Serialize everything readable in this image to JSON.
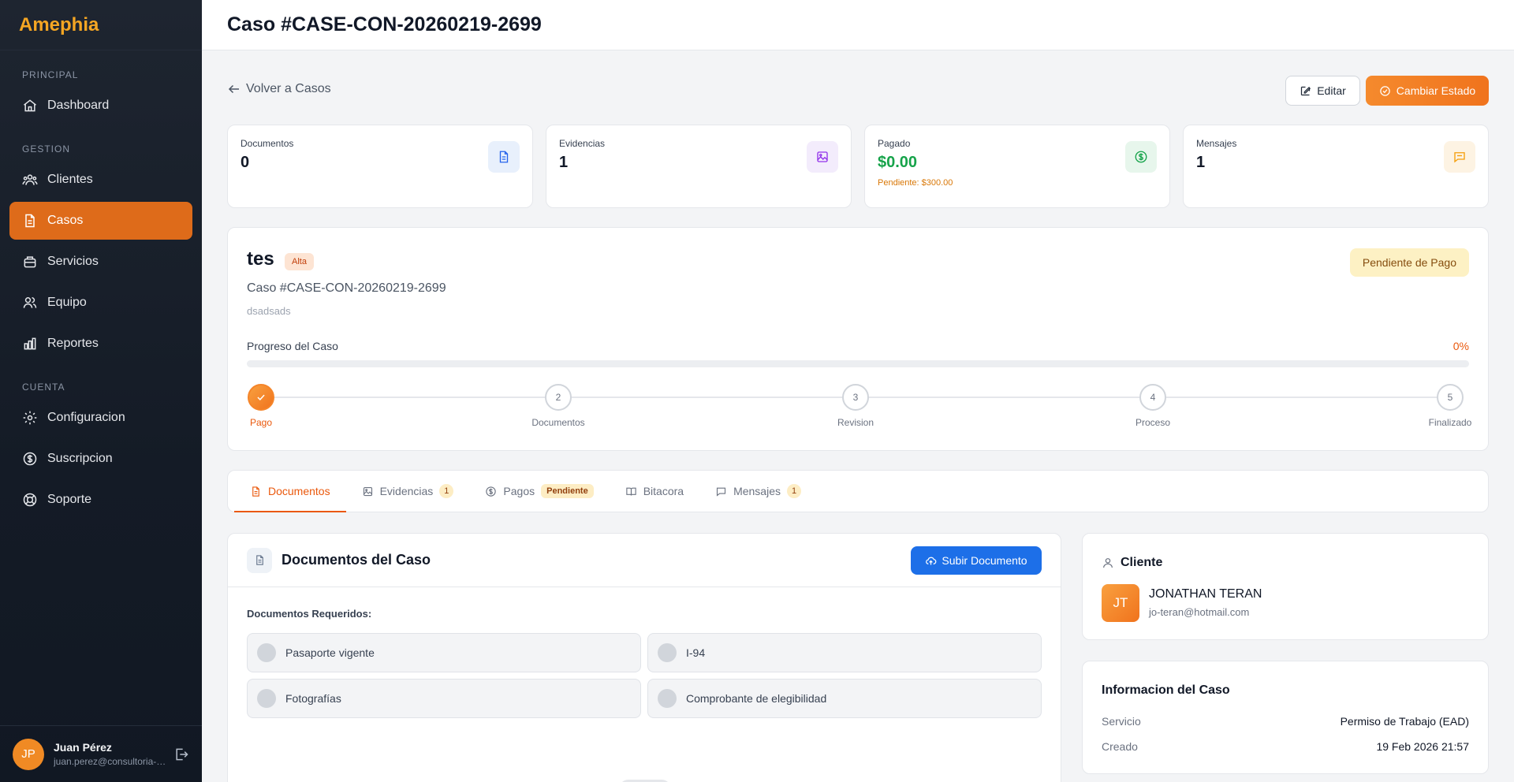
{
  "app": {
    "brand": "Amephia"
  },
  "sidebar": {
    "sections": {
      "principal": "PRINCIPAL",
      "gestion": "GESTION",
      "cuenta": "CUENTA"
    },
    "items": {
      "dashboard": "Dashboard",
      "clientes": "Clientes",
      "casos": "Casos",
      "servicios": "Servicios",
      "equipo": "Equipo",
      "reportes": "Reportes",
      "configuracion": "Configuracion",
      "suscripcion": "Suscripcion",
      "soporte": "Soporte"
    },
    "active": "casos",
    "user": {
      "initials": "JP",
      "name": "Juan Pérez",
      "email": "juan.perez@consultoria-a..."
    }
  },
  "header": {
    "title": "Caso #CASE-CON-20260219-2699"
  },
  "actions": {
    "back": "Volver a Casos",
    "edit": "Editar",
    "change_state": "Cambiar Estado"
  },
  "stats": {
    "documentos": {
      "label": "Documentos",
      "value": "0"
    },
    "evidencias": {
      "label": "Evidencias",
      "value": "1"
    },
    "pagado": {
      "label": "Pagado",
      "value": "$0.00",
      "sub": "Pendiente: $300.00"
    },
    "mensajes": {
      "label": "Mensajes",
      "value": "1"
    }
  },
  "case": {
    "title": "tes",
    "priority": "Alta",
    "code": "Caso #CASE-CON-20260219-2699",
    "description": "dsadsads",
    "status": "Pendiente de Pago",
    "progress_label": "Progreso del Caso",
    "progress_text": "0%",
    "progress": 0,
    "steps": [
      {
        "num": "",
        "label": "Pago",
        "done": true
      },
      {
        "num": "2",
        "label": "Documentos",
        "done": false
      },
      {
        "num": "3",
        "label": "Revision",
        "done": false
      },
      {
        "num": "4",
        "label": "Proceso",
        "done": false
      },
      {
        "num": "5",
        "label": "Finalizado",
        "done": false
      }
    ]
  },
  "tabs": {
    "documentos": {
      "label": "Documentos"
    },
    "evidencias": {
      "label": "Evidencias",
      "badge": "1"
    },
    "pagos": {
      "label": "Pagos",
      "badge": "Pendiente"
    },
    "bitacora": {
      "label": "Bitacora"
    },
    "mensajes": {
      "label": "Mensajes",
      "badge": "1"
    }
  },
  "documents": {
    "title": "Documentos del Caso",
    "upload": "Subir Documento",
    "required_title": "Documentos Requeridos:",
    "required": [
      "Pasaporte vigente",
      "I-94",
      "Fotografías",
      "Comprobante de elegibilidad"
    ]
  },
  "client": {
    "heading": "Cliente",
    "initials": "JT",
    "name": "JONATHAN TERAN",
    "email": "jo-teran@hotmail.com"
  },
  "info": {
    "title": "Informacion del Caso",
    "servicio_label": "Servicio",
    "servicio": "Permiso de Trabajo (EAD)",
    "creado_label": "Creado",
    "creado": "19 Feb 2026 21:57"
  },
  "colors": {
    "accent": "#f0731d",
    "sidebar_bg": "#141b26",
    "primary_blue": "#1d6fe8",
    "success": "#16a34a"
  }
}
